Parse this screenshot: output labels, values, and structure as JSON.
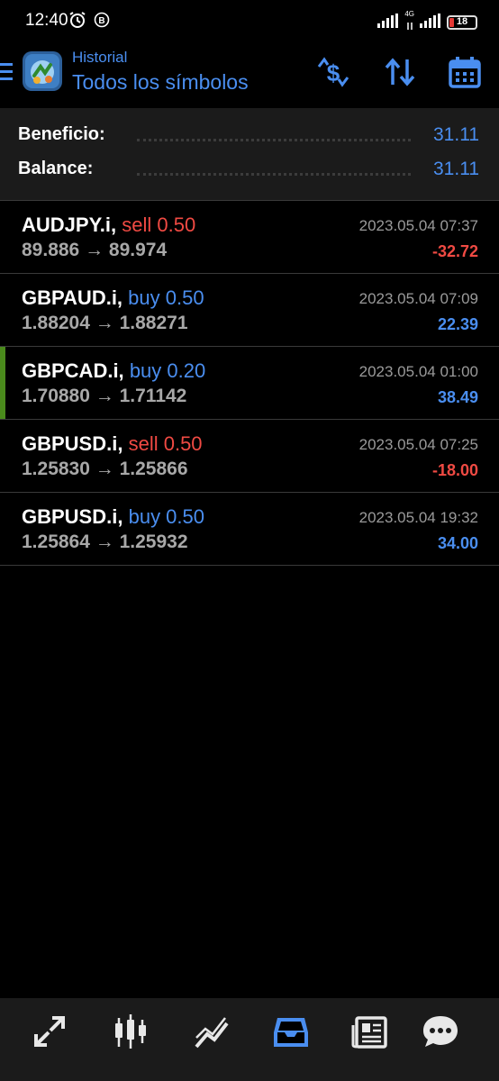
{
  "status_bar": {
    "time": "12:40",
    "network": "4G",
    "battery": "18",
    "battery_level": 0.18
  },
  "header": {
    "subtitle": "Historial",
    "title": "Todos los símbolos"
  },
  "summary": {
    "profit_label": "Beneficio:",
    "profit_value": "31.11",
    "balance_label": "Balance:",
    "balance_value": "31.11"
  },
  "trades": [
    {
      "symbol": "AUDJPY.i,",
      "side": "sell 0.50",
      "direction": "sell",
      "open": "89.886",
      "close": "89.974",
      "arrow": "→",
      "time": "2023.05.04 07:37",
      "profit": "-32.72"
    },
    {
      "symbol": "GBPAUD.i,",
      "side": "buy 0.50",
      "direction": "buy",
      "open": "1.88204",
      "close": "1.88271",
      "arrow": "→",
      "time": "2023.05.04 07:09",
      "profit": "22.39"
    },
    {
      "symbol": "GBPCAD.i,",
      "side": "buy 0.20",
      "direction": "buy",
      "open": "1.70880",
      "close": "1.71142",
      "arrow": "→",
      "time": "2023.05.04 01:00",
      "profit": "38.49"
    },
    {
      "symbol": "GBPUSD.i,",
      "side": "sell 0.50",
      "direction": "sell",
      "open": "1.25830",
      "close": "1.25866",
      "arrow": "→",
      "time": "2023.05.04 07:25",
      "profit": "-18.00"
    },
    {
      "symbol": "GBPUSD.i,",
      "side": "buy 0.50",
      "direction": "buy",
      "open": "1.25864",
      "close": "1.25932",
      "arrow": "→",
      "time": "2023.05.04 19:32",
      "profit": "34.00"
    }
  ],
  "icons": {
    "header": [
      "currency-swap-icon",
      "sort-icon",
      "calendar-icon"
    ],
    "nav": [
      "trade-icon",
      "quotes-icon",
      "chart-icon",
      "history-icon",
      "news-icon",
      "chat-icon"
    ],
    "active_nav": "history-icon"
  },
  "colors": {
    "accent": "#4a8ef0",
    "sell": "#f04a43",
    "active_marker": "#4a8a1c",
    "nav_inactive": "#e8e8e8"
  }
}
